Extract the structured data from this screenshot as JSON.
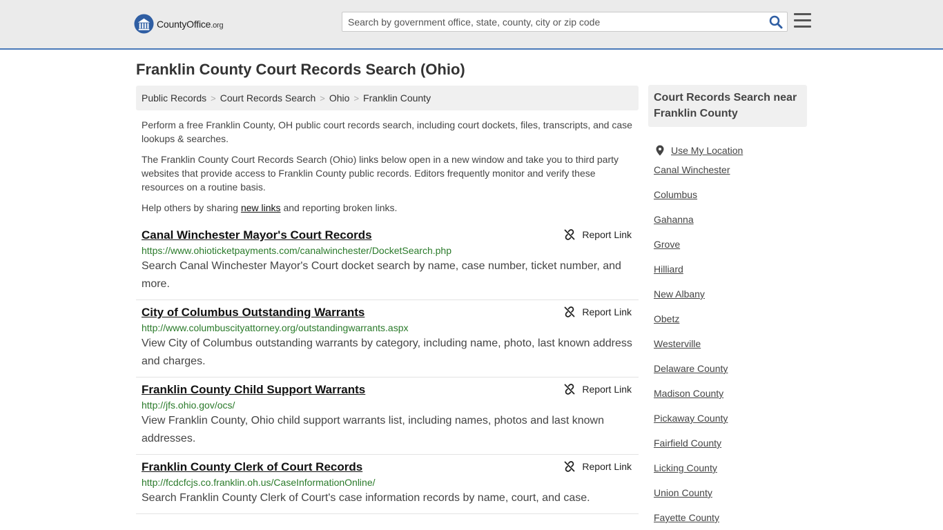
{
  "header": {
    "logo_main": "CountyOffice",
    "logo_suffix": ".org",
    "search_placeholder": "Search by government office, state, county, city or zip code"
  },
  "page_title": "Franklin County Court Records Search (Ohio)",
  "breadcrumb": [
    "Public Records",
    "Court Records Search",
    "Ohio",
    "Franklin County"
  ],
  "breadcrumb_sep": ">",
  "intro": {
    "p1": "Perform a free Franklin County, OH public court records search, including court dockets, files, transcripts, and case lookups & searches.",
    "p2": "The Franklin County Court Records Search (Ohio) links below open in a new window and take you to third party websites that provide access to Franklin County public records. Editors frequently monitor and verify these resources on a routine basis.",
    "p3_before": "Help others by sharing ",
    "p3_link": "new links",
    "p3_after": " and reporting broken links."
  },
  "report_label": "Report Link",
  "records": [
    {
      "title": "Canal Winchester Mayor's Court Records",
      "url": "https://www.ohioticketpayments.com/canalwinchester/DocketSearch.php",
      "desc": "Search Canal Winchester Mayor's Court docket search by name, case number, ticket number, and more."
    },
    {
      "title": "City of Columbus Outstanding Warrants",
      "url": "http://www.columbuscityattorney.org/outstandingwarrants.aspx",
      "desc": "View City of Columbus outstanding warrants by category, including name, photo, last known address and charges."
    },
    {
      "title": "Franklin County Child Support Warrants",
      "url": "http://jfs.ohio.gov/ocs/",
      "desc": "View Franklin County, Ohio child support warrants list, including names, photos and last known addresses."
    },
    {
      "title": "Franklin County Clerk of Court Records",
      "url": "http://fcdcfcjs.co.franklin.oh.us/CaseInformationOnline/",
      "desc": "Search Franklin County Clerk of Court's case information records by name, court, and case."
    }
  ],
  "sidebar": {
    "heading": "Court Records Search near Franklin County",
    "use_location": "Use My Location",
    "links": [
      "Canal Winchester",
      "Columbus",
      "Gahanna",
      "Grove",
      "Hilliard",
      "New Albany",
      "Obetz",
      "Westerville",
      "Delaware County",
      "Madison County",
      "Pickaway County",
      "Fairfield County",
      "Licking County",
      "Union County",
      "Fayette County"
    ]
  },
  "colors": {
    "header_bg": "#ebebeb",
    "header_border": "#4a79b8",
    "url_green": "#2a7a2a",
    "logo_blue": "#2f5ea3"
  }
}
